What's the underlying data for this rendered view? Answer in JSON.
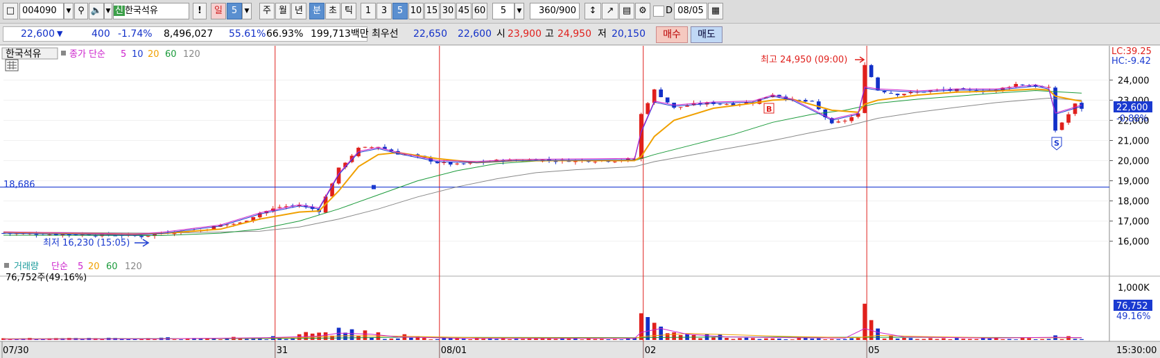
{
  "toolbar": {
    "code": "004090",
    "badge": "신",
    "name": "한국석유",
    "alert": "!",
    "day": "일",
    "day_num": "5",
    "week": "주",
    "month": "월",
    "year": "년",
    "minute": "분",
    "second": "초",
    "tick": "틱",
    "intervals": [
      "1",
      "3",
      "5",
      "10",
      "15",
      "30",
      "45",
      "60"
    ],
    "selected_interval": "5",
    "interval_input": "5",
    "count": "360",
    "count_total": "/900",
    "d_label": "D",
    "date": "08/05"
  },
  "quote": {
    "price": "22,600",
    "change": "400",
    "change_pct": "-1.74%",
    "volume": "8,496,027",
    "ratio1": "55.61%",
    "ratio2": "66.93%",
    "amount": "199,713백만",
    "best_label": "최우선",
    "best_ask": "22,650",
    "best_bid": "22,600",
    "open_label": "시",
    "open": "23,900",
    "high_label": "고",
    "high": "24,950",
    "low_label": "저",
    "low": "20,150",
    "buy": "매수",
    "sell": "매도",
    "up_color": "#e0201c",
    "down_color": "#1230c8"
  },
  "price_panel": {
    "name": "한국석유",
    "ma_label": "종가 단순",
    "ma_periods": [
      "5",
      "10",
      "20",
      "60",
      "120"
    ],
    "ma_colors": [
      "#cc22cc",
      "#1a3ad0",
      "#f0a000",
      "#1a9a3a",
      "#888888"
    ],
    "lc": "LC:39.25",
    "hc": "HC:-9.42",
    "current_price": "22,600",
    "current_pct": "-0.88%",
    "high_note": "최고 24,950 (09:00)",
    "low_note": "최저 16,230 (15:05)",
    "hline_value": "18,686",
    "buy_marker": "B",
    "sell_marker": "S"
  },
  "volume_panel": {
    "title": "거래량",
    "ma_label": "단순",
    "ma_periods": [
      "5",
      "20",
      "60",
      "120"
    ],
    "current": "76,752주(49.16%)",
    "axis_label": "1,000K",
    "current_value": "76,752",
    "current_pct": "49.16%"
  },
  "time_axis": {
    "labels": [
      "07/30",
      "31",
      "08/01",
      "02",
      "05"
    ],
    "end_time": "15:30:00"
  },
  "chart_data": {
    "type": "candlestick",
    "y_ticks": [
      16000,
      17000,
      18000,
      19000,
      20000,
      21000,
      22000,
      23000,
      24000
    ],
    "y_tick_labels": [
      "16,000",
      "17,000",
      "18,000",
      "19,000",
      "20,000",
      "21,000",
      "22,000",
      "23,000",
      "24,000"
    ],
    "ylim": [
      15300,
      25700
    ],
    "volume_ylim": [
      0,
      1600000
    ],
    "volume_tick": 1000000,
    "hline": 18686,
    "sessions": [
      "07/30",
      "07/31",
      "08/01",
      "08/02",
      "08/05"
    ],
    "close_path": [
      [
        0,
        16400
      ],
      [
        6,
        16350
      ],
      [
        12,
        16330
      ],
      [
        18,
        16300
      ],
      [
        21,
        16240
      ],
      [
        24,
        16400
      ],
      [
        27,
        16480
      ],
      [
        30,
        16550
      ],
      [
        33,
        16800
      ],
      [
        36,
        16900
      ],
      [
        39,
        17400
      ],
      [
        42,
        17700
      ],
      [
        45,
        17800
      ],
      [
        48,
        17500
      ],
      [
        51,
        19600
      ],
      [
        54,
        20600
      ],
      [
        57,
        20700
      ],
      [
        60,
        20350
      ],
      [
        63,
        20200
      ],
      [
        66,
        19900
      ],
      [
        69,
        19800
      ],
      [
        72,
        19900
      ],
      [
        75,
        20000
      ],
      [
        78,
        20000
      ],
      [
        81,
        20050
      ],
      [
        84,
        20000
      ],
      [
        87,
        20000
      ],
      [
        90,
        20000
      ],
      [
        93,
        20000
      ],
      [
        96,
        20100
      ],
      [
        97,
        22300
      ],
      [
        99,
        23500
      ],
      [
        102,
        22600
      ],
      [
        105,
        22800
      ],
      [
        108,
        22850
      ],
      [
        111,
        22800
      ],
      [
        114,
        22900
      ],
      [
        117,
        23300
      ],
      [
        120,
        23000
      ],
      [
        123,
        22900
      ],
      [
        126,
        21800
      ],
      [
        128,
        22000
      ],
      [
        130,
        22300
      ],
      [
        131,
        24800
      ],
      [
        133,
        23500
      ],
      [
        136,
        23300
      ],
      [
        139,
        23400
      ],
      [
        142,
        23500
      ],
      [
        145,
        23500
      ],
      [
        148,
        23450
      ],
      [
        151,
        23500
      ],
      [
        154,
        23800
      ],
      [
        157,
        23700
      ],
      [
        159,
        23600
      ],
      [
        160,
        21500
      ],
      [
        162,
        22300
      ],
      [
        163,
        22800
      ],
      [
        164,
        22600
      ]
    ],
    "ma5": [
      [
        0,
        16400
      ],
      [
        20,
        16300
      ],
      [
        24,
        16380
      ],
      [
        33,
        16750
      ],
      [
        39,
        17350
      ],
      [
        45,
        17750
      ],
      [
        48,
        17600
      ],
      [
        51,
        19300
      ],
      [
        54,
        20400
      ],
      [
        57,
        20600
      ],
      [
        60,
        20350
      ],
      [
        66,
        19950
      ],
      [
        72,
        19900
      ],
      [
        78,
        20000
      ],
      [
        96,
        20050
      ],
      [
        97,
        21400
      ],
      [
        99,
        22900
      ],
      [
        102,
        22700
      ],
      [
        108,
        22850
      ],
      [
        114,
        22900
      ],
      [
        117,
        23200
      ],
      [
        120,
        23000
      ],
      [
        126,
        22000
      ],
      [
        130,
        22300
      ],
      [
        131,
        23600
      ],
      [
        133,
        23500
      ],
      [
        139,
        23400
      ],
      [
        145,
        23500
      ],
      [
        151,
        23500
      ],
      [
        157,
        23700
      ],
      [
        159,
        23550
      ],
      [
        160,
        22300
      ],
      [
        163,
        22600
      ],
      [
        164,
        22700
      ]
    ],
    "ma20": [
      [
        0,
        16450
      ],
      [
        20,
        16350
      ],
      [
        24,
        16380
      ],
      [
        33,
        16600
      ],
      [
        39,
        17100
      ],
      [
        45,
        17450
      ],
      [
        48,
        17500
      ],
      [
        51,
        18500
      ],
      [
        54,
        19700
      ],
      [
        57,
        20300
      ],
      [
        60,
        20400
      ],
      [
        66,
        20100
      ],
      [
        72,
        19900
      ],
      [
        78,
        20000
      ],
      [
        96,
        20000
      ],
      [
        97,
        20200
      ],
      [
        99,
        21200
      ],
      [
        102,
        22000
      ],
      [
        108,
        22600
      ],
      [
        114,
        22850
      ],
      [
        117,
        23000
      ],
      [
        120,
        23050
      ],
      [
        126,
        22500
      ],
      [
        130,
        22400
      ],
      [
        131,
        22800
      ],
      [
        133,
        23000
      ],
      [
        139,
        23250
      ],
      [
        145,
        23400
      ],
      [
        151,
        23450
      ],
      [
        157,
        23550
      ],
      [
        159,
        23500
      ],
      [
        160,
        23200
      ],
      [
        163,
        23000
      ],
      [
        164,
        22950
      ]
    ],
    "ma60": [
      [
        0,
        16300
      ],
      [
        24,
        16280
      ],
      [
        33,
        16400
      ],
      [
        39,
        16600
      ],
      [
        45,
        17000
      ],
      [
        51,
        17600
      ],
      [
        57,
        18300
      ],
      [
        63,
        19000
      ],
      [
        69,
        19500
      ],
      [
        75,
        19850
      ],
      [
        81,
        19980
      ],
      [
        96,
        20000
      ],
      [
        99,
        20300
      ],
      [
        105,
        20800
      ],
      [
        111,
        21300
      ],
      [
        117,
        21900
      ],
      [
        123,
        22300
      ],
      [
        128,
        22500
      ],
      [
        133,
        22850
      ],
      [
        139,
        23050
      ],
      [
        145,
        23200
      ],
      [
        151,
        23350
      ],
      [
        157,
        23480
      ],
      [
        164,
        23350
      ]
    ],
    "ma120": [
      [
        0,
        16450
      ],
      [
        24,
        16400
      ],
      [
        39,
        16500
      ],
      [
        45,
        16700
      ],
      [
        51,
        17100
      ],
      [
        57,
        17600
      ],
      [
        63,
        18200
      ],
      [
        69,
        18700
      ],
      [
        75,
        19100
      ],
      [
        81,
        19400
      ],
      [
        87,
        19550
      ],
      [
        96,
        19700
      ],
      [
        99,
        19950
      ],
      [
        105,
        20300
      ],
      [
        111,
        20650
      ],
      [
        117,
        21000
      ],
      [
        123,
        21400
      ],
      [
        128,
        21700
      ],
      [
        133,
        22100
      ],
      [
        139,
        22400
      ],
      [
        145,
        22650
      ],
      [
        151,
        22880
      ],
      [
        157,
        23050
      ],
      [
        159,
        23100
      ],
      [
        164,
        23000
      ]
    ],
    "volume_spikes": [
      [
        25,
        70000
      ],
      [
        35,
        80000
      ],
      [
        41,
        100000
      ],
      [
        45,
        150000
      ],
      [
        49,
        200000
      ],
      [
        51,
        320000
      ],
      [
        53,
        280000
      ],
      [
        55,
        250000
      ],
      [
        57,
        200000
      ],
      [
        61,
        150000
      ],
      [
        63,
        100000
      ],
      [
        97,
        700000
      ],
      [
        98,
        600000
      ],
      [
        99,
        450000
      ],
      [
        100,
        350000
      ],
      [
        102,
        200000
      ],
      [
        104,
        150000
      ],
      [
        131,
        950000
      ],
      [
        132,
        520000
      ],
      [
        133,
        300000
      ],
      [
        135,
        120000
      ],
      [
        160,
        120000
      ],
      [
        162,
        100000
      ]
    ],
    "vol_ma5": [
      [
        0,
        20000
      ],
      [
        24,
        30000
      ],
      [
        40,
        60000
      ],
      [
        48,
        100000
      ],
      [
        51,
        180000
      ],
      [
        56,
        150000
      ],
      [
        60,
        80000
      ],
      [
        70,
        40000
      ],
      [
        96,
        40000
      ],
      [
        97,
        200000
      ],
      [
        100,
        300000
      ],
      [
        104,
        150000
      ],
      [
        110,
        80000
      ],
      [
        120,
        60000
      ],
      [
        128,
        50000
      ],
      [
        131,
        300000
      ],
      [
        133,
        200000
      ],
      [
        137,
        80000
      ],
      [
        150,
        50000
      ],
      [
        160,
        70000
      ],
      [
        164,
        60000
      ]
    ],
    "vol_ma20": [
      [
        0,
        30000
      ],
      [
        24,
        30000
      ],
      [
        45,
        60000
      ],
      [
        52,
        110000
      ],
      [
        60,
        100000
      ],
      [
        72,
        60000
      ],
      [
        96,
        50000
      ],
      [
        98,
        100000
      ],
      [
        104,
        170000
      ],
      [
        110,
        140000
      ],
      [
        120,
        90000
      ],
      [
        130,
        60000
      ],
      [
        133,
        120000
      ],
      [
        140,
        90000
      ],
      [
        150,
        60000
      ],
      [
        164,
        60000
      ]
    ],
    "vol_ma60": [
      [
        0,
        30000
      ],
      [
        45,
        40000
      ],
      [
        60,
        70000
      ],
      [
        96,
        60000
      ],
      [
        110,
        80000
      ],
      [
        130,
        70000
      ],
      [
        150,
        65000
      ],
      [
        164,
        60000
      ]
    ]
  }
}
